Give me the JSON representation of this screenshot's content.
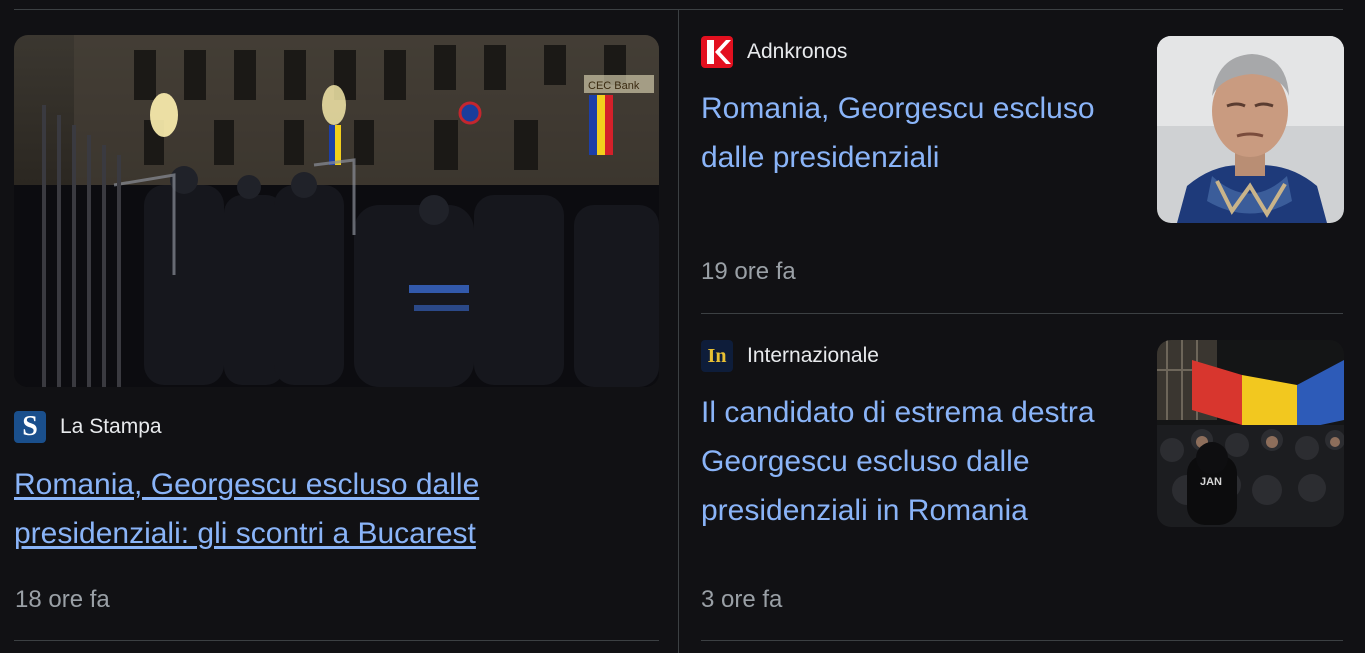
{
  "articles": [
    {
      "source": "La Stampa",
      "logo_text": "S",
      "headline": "Romania, Georgescu escluso dalle presidenziali: gli scontri a Bucarest",
      "time": "18 ore fa",
      "image": "police-protest-photo"
    },
    {
      "source": "Adnkronos",
      "logo_text": "K",
      "headline": "Romania, Georgescu escluso dalle presidenziali",
      "time": "19 ore fa",
      "image": "georgescu-portrait-photo"
    },
    {
      "source": "Internazionale",
      "logo_text": "In",
      "headline": "Il candidato di estrema destra Georgescu escluso dalle presidenziali in Romania",
      "time": "3 ore fa",
      "image": "protest-flags-photo"
    }
  ],
  "hero_sign": "CEC Bank",
  "colors": {
    "background": "#111114",
    "link": "#8ab4f8",
    "source_text": "#e8eaed",
    "meta_text": "#9aa0a6",
    "divider": "#3c4043",
    "lastampa_logo": "#1a4f8c",
    "adnkronos_logo": "#e3101f",
    "internazionale_logo": "#0e1d3a"
  }
}
